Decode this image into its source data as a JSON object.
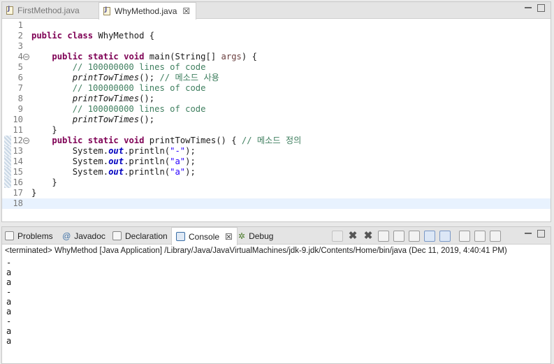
{
  "editor": {
    "tabs": [
      {
        "label": "FirstMethod.java",
        "active": false
      },
      {
        "label": "WhyMethod.java",
        "active": true
      }
    ],
    "lines": [
      {
        "n": "1",
        "spans": []
      },
      {
        "n": "2",
        "spans": [
          {
            "t": "public",
            "c": "kw"
          },
          {
            "t": " "
          },
          {
            "t": "class",
            "c": "kw"
          },
          {
            "t": " WhyMethod {"
          }
        ]
      },
      {
        "n": "3",
        "spans": []
      },
      {
        "n": "4",
        "fold": true,
        "spans": [
          {
            "t": "    "
          },
          {
            "t": "public",
            "c": "kw"
          },
          {
            "t": " "
          },
          {
            "t": "static",
            "c": "kw"
          },
          {
            "t": " "
          },
          {
            "t": "void",
            "c": "kw"
          },
          {
            "t": " main(String[] "
          },
          {
            "t": "args",
            "c": "pm"
          },
          {
            "t": ") {"
          }
        ]
      },
      {
        "n": "5",
        "spans": [
          {
            "t": "        "
          },
          {
            "t": "// 100000000 lines of code",
            "c": "cm"
          }
        ]
      },
      {
        "n": "6",
        "spans": [
          {
            "t": "        "
          },
          {
            "t": "printTowTimes",
            "c": "it"
          },
          {
            "t": "(); "
          },
          {
            "t": "// 메소드 사용",
            "c": "cm"
          }
        ]
      },
      {
        "n": "7",
        "spans": [
          {
            "t": "        "
          },
          {
            "t": "// 100000000 lines of code",
            "c": "cm"
          }
        ]
      },
      {
        "n": "8",
        "spans": [
          {
            "t": "        "
          },
          {
            "t": "printTowTimes",
            "c": "it"
          },
          {
            "t": "();"
          }
        ]
      },
      {
        "n": "9",
        "spans": [
          {
            "t": "        "
          },
          {
            "t": "// 100000000 lines of code",
            "c": "cm"
          }
        ]
      },
      {
        "n": "10",
        "spans": [
          {
            "t": "        "
          },
          {
            "t": "printTowTimes",
            "c": "it"
          },
          {
            "t": "();"
          }
        ]
      },
      {
        "n": "11",
        "spans": [
          {
            "t": "    }"
          }
        ]
      },
      {
        "n": "12",
        "fold": true,
        "spans": [
          {
            "t": "    "
          },
          {
            "t": "public",
            "c": "kw"
          },
          {
            "t": " "
          },
          {
            "t": "static",
            "c": "kw"
          },
          {
            "t": " "
          },
          {
            "t": "void",
            "c": "kw"
          },
          {
            "t": " printTowTimes() { "
          },
          {
            "t": "// 메소드 정의",
            "c": "cm"
          }
        ]
      },
      {
        "n": "13",
        "spans": [
          {
            "t": "        System."
          },
          {
            "t": "out",
            "c": "fi"
          },
          {
            "t": ".println("
          },
          {
            "t": "\"-\"",
            "c": "st"
          },
          {
            "t": ");"
          }
        ]
      },
      {
        "n": "14",
        "spans": [
          {
            "t": "        System."
          },
          {
            "t": "out",
            "c": "fi"
          },
          {
            "t": ".println("
          },
          {
            "t": "\"a\"",
            "c": "st"
          },
          {
            "t": ");"
          }
        ]
      },
      {
        "n": "15",
        "spans": [
          {
            "t": "        System."
          },
          {
            "t": "out",
            "c": "fi"
          },
          {
            "t": ".println("
          },
          {
            "t": "\"a\"",
            "c": "st"
          },
          {
            "t": ");"
          }
        ]
      },
      {
        "n": "16",
        "spans": [
          {
            "t": "    }"
          }
        ]
      },
      {
        "n": "17",
        "spans": [
          {
            "t": "}"
          }
        ]
      },
      {
        "n": "18",
        "current": true,
        "spans": []
      }
    ]
  },
  "view": {
    "tabs": [
      {
        "label": "Problems",
        "icon": "problems-icon"
      },
      {
        "label": "Javadoc",
        "icon": "javadoc-icon"
      },
      {
        "label": "Declaration",
        "icon": "declaration-icon"
      },
      {
        "label": "Console",
        "icon": "console-icon",
        "active": true
      },
      {
        "label": "Debug",
        "icon": "debug-icon"
      }
    ],
    "toolbar_icons": [
      "terminate-icon",
      "remove-launch-icon",
      "remove-all-terminated-icon",
      "clear-console-icon",
      "scroll-lock-icon",
      "word-wrap-icon",
      "show-on-stdout-icon",
      "show-on-stderr-icon",
      "pin-console-icon",
      "display-console-icon",
      "open-console-icon"
    ],
    "status": "<terminated> WhyMethod [Java Application] /Library/Java/JavaVirtualMachines/jdk-9.jdk/Contents/Home/bin/java (Dec 11, 2019, 4:40:41 PM)",
    "output": [
      "-",
      "a",
      "a",
      "-",
      "a",
      "a",
      "-",
      "a",
      "a"
    ]
  },
  "colors": {
    "keyword": "#7f0055",
    "comment": "#3f7f5f",
    "string": "#2a00ff",
    "field": "#0000c0",
    "current_line": "#e8f2fe"
  }
}
